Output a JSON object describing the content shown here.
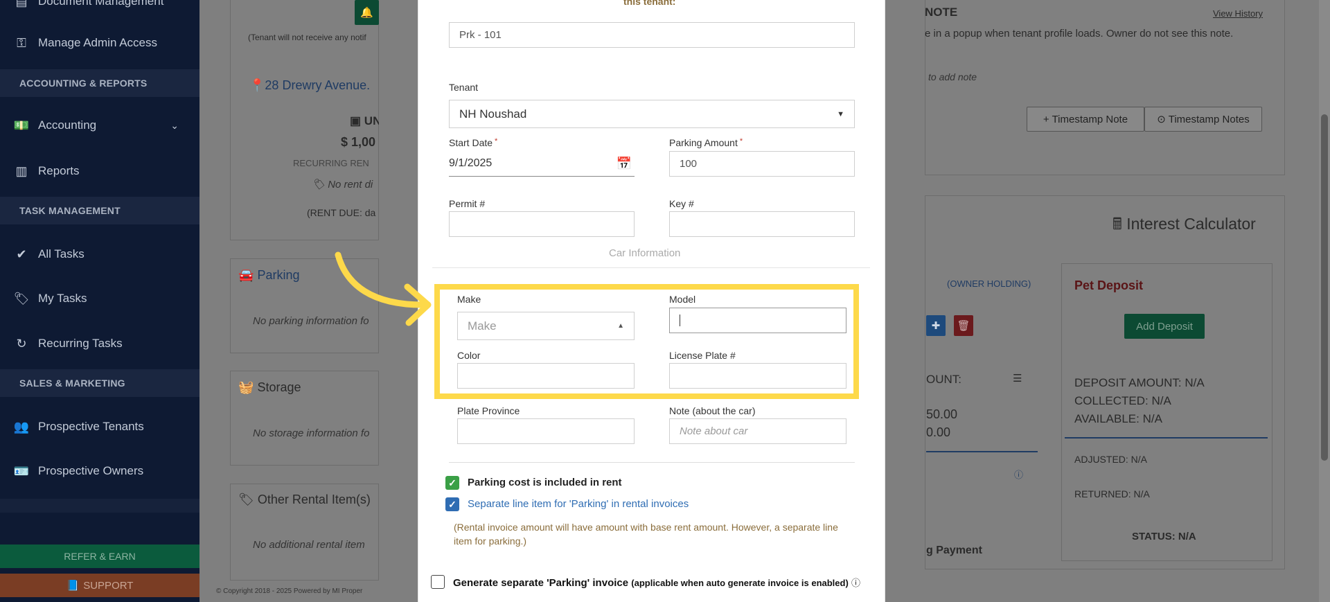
{
  "sidebar": {
    "top_partial": "Document Management",
    "manage_admin": "Manage Admin Access",
    "sec_accounting": "ACCOUNTING & REPORTS",
    "accounting": "Accounting",
    "reports": "Reports",
    "sec_task": "TASK MANAGEMENT",
    "all_tasks": "All Tasks",
    "my_tasks": "My Tasks",
    "recurring_tasks": "Recurring Tasks",
    "sec_sales": "SALES & MARKETING",
    "prospective_tenants": "Prospective Tenants",
    "prospective_owners": "Prospective Owners",
    "refer": "REFER & EARN",
    "support": "SUPPORT"
  },
  "background": {
    "tenant_note": "(Tenant will not receive any notif",
    "address": "28 Drewry Avenue.",
    "unit": "UN",
    "amount": "$ 1,00",
    "recurring": "RECURRING REN",
    "no_rent": "No rent di",
    "rent_due": "(RENT DUE: da",
    "parking_title": "Parking",
    "parking_empty": "No parking information fo",
    "storage_title": "Storage",
    "storage_empty": "No storage information fo",
    "other_title": "Other Rental Item(s)",
    "other_empty": "No additional rental item",
    "copyright": "© Copyright 2018 - 2025 Powered by MI Proper",
    "note_title": "NOTE",
    "view_history": "View History",
    "note_desc": "e in a popup when tenant profile loads. Owner do not see this note.",
    "add_note": "to add note",
    "timestamp_note": "+ Timestamp Note",
    "timestamp_notes": "⊙ Timestamp Notes",
    "interest_calc": "Interest Calculator",
    "owner_holding": "(OWNER HOLDING)",
    "ount": "OUNT:",
    "val1": "50.00",
    "val2": "0.00",
    "payment": "g Payment",
    "pet_deposit": "Pet Deposit",
    "add_deposit": "Add Deposit",
    "deposit_amount": "DEPOSIT AMOUNT:",
    "collected": "COLLECTED:",
    "available": "AVAILABLE:",
    "na": "N/A",
    "adjusted": "ADJUSTED: N/A",
    "returned": "RETURNED: N/A",
    "status": "STATUS: N/A"
  },
  "modal": {
    "top_text": "this tenant:",
    "parking_spot": "Prk - 101",
    "tenant_label": "Tenant",
    "tenant_value": "NH Noushad",
    "start_date_label": "Start Date",
    "start_date_value": "9/1/2025",
    "parking_amount_label": "Parking Amount",
    "parking_amount_value": "100",
    "permit_label": "Permit #",
    "key_label": "Key #",
    "car_info": "Car Information",
    "make_label": "Make",
    "make_placeholder": "Make",
    "model_label": "Model",
    "color_label": "Color",
    "plate_label": "License Plate #",
    "province_label": "Plate Province",
    "note_label": "Note (about the car)",
    "note_placeholder": "Note about car",
    "included_label": "Parking cost is included in rent",
    "separate_label": "Separate line item for 'Parking' in rental invoices",
    "explain": "(Rental invoice amount will have amount with base rent amount. However, a separate line item for parking.)",
    "generate_label": "Generate separate 'Parking' invoice",
    "generate_note": "(applicable when auto generate invoice is enabled)"
  },
  "colors": {
    "highlight": "#fdd94a",
    "sidebar": "#0e1a33",
    "check_green": "#3aa046",
    "check_blue": "#2f6db3"
  }
}
